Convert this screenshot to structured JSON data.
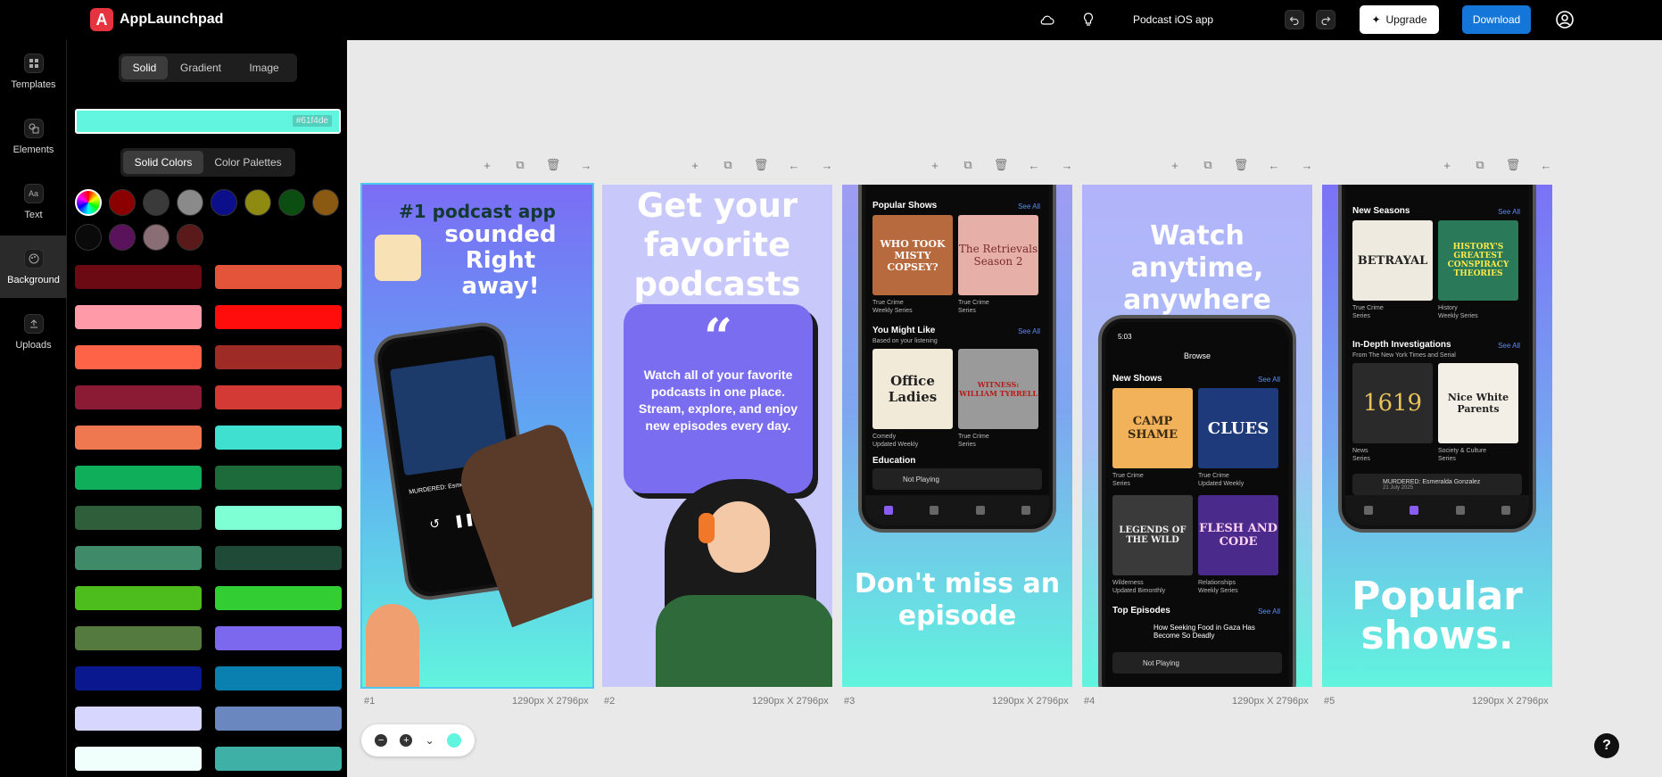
{
  "app": {
    "logo_letter": "A",
    "name": "AppLaunchpad"
  },
  "topbar": {
    "project_name": "Podcast iOS app",
    "upgrade_label": "Upgrade",
    "download_label": "Download"
  },
  "rail": {
    "items": [
      {
        "label": "Templates",
        "icon": "templates-icon"
      },
      {
        "label": "Elements",
        "icon": "elements-icon"
      },
      {
        "label": "Text",
        "icon": "text-icon"
      },
      {
        "label": "Background",
        "icon": "background-icon",
        "active": true
      },
      {
        "label": "Uploads",
        "icon": "upload-icon"
      }
    ]
  },
  "panel": {
    "fill_tabs": [
      "Solid",
      "Gradient",
      "Image"
    ],
    "fill_active": "Solid",
    "current_color": "#61f4de",
    "current_color_label": "#61f4de",
    "color_tabs": [
      "Solid Colors",
      "Color Palettes"
    ],
    "color_tab_active": "Solid Colors",
    "swatches": [
      "#8b0000",
      "#3a3a3a",
      "#8a8a8a",
      "#0b0f8a",
      "#8e8a12",
      "#0c4d12",
      "#8b5a12",
      "#0a0a0a",
      "#5a125a",
      "#8a6e75",
      "#5a1a1a"
    ],
    "bars": [
      [
        "#6b0a12",
        "#e4543a"
      ],
      [
        "#ff9aa8",
        "#ff0d0d"
      ],
      [
        "#ff6347",
        "#9e2b25"
      ],
      [
        "#8b1a35",
        "#d33a35"
      ],
      [
        "#f07850",
        "#40e0d0"
      ],
      [
        "#0fae5a",
        "#1d6b3a"
      ],
      [
        "#2f5e3a",
        "#7fffd4"
      ],
      [
        "#3f8a68",
        "#1f4a38"
      ],
      [
        "#4cbd1d",
        "#32cd32"
      ],
      [
        "#557a3f",
        "#7b68ee"
      ],
      [
        "#0a1890",
        "#0a80b0"
      ],
      [
        "#d6d6ff",
        "#6a88bf"
      ],
      [
        "#f0fffb",
        "#3fb0a6"
      ]
    ]
  },
  "frames": [
    {
      "index": "#1",
      "size": "1290px X 2796px",
      "headline_top": "#1 podcast app",
      "headline": "sounded\nRight\naway!",
      "phone_title": "MURDERED: Esmeralda Gonzalez"
    },
    {
      "index": "#2",
      "size": "1290px X 2796px",
      "headline": "Get your\nfavorite\npodcasts",
      "quote_mark": "“",
      "quote": "Watch all of your favorite podcasts in one place. Stream, explore, and enjoy new episodes every day."
    },
    {
      "index": "#3",
      "size": "1290px X 2796px",
      "section1": "Popular Shows",
      "see_all": "See All",
      "card1": "WHO TOOK MISTY COPSEY?",
      "card2": "The Retrievals Season 2",
      "meta1": "True Crime\nWeekly Series",
      "meta2": "True Crime\nSeries",
      "section2": "You Might Like",
      "section2_sub": "Based on your listening",
      "card3": "Office Ladies",
      "card4": "WITNESS: WILLIAM TYRRELL",
      "meta3": "Comedy\nUpdated Weekly",
      "meta4": "True Crime\nSeries",
      "section3": "Education",
      "now_playing": "Not Playing",
      "footer": "Don't miss an\nepisode"
    },
    {
      "index": "#4",
      "size": "1290px X 2796px",
      "headline": "Watch anytime,\nanywhere",
      "time": "5:03",
      "browse": "Browse",
      "section1": "New Shows",
      "see_all": "See All",
      "card1": "CAMP SHAME",
      "card2": "CLUES",
      "meta1": "True Crime\nSeries",
      "meta2": "True Crime\nUpdated Weekly",
      "card3": "LEGENDS OF THE WILD",
      "card4": "FLESH AND CODE",
      "meta3": "Wilderness\nUpdated Bimonthly",
      "meta4": "Relationships\nWeekly Series",
      "section2": "Top Episodes",
      "episode": "How Seeking Food in Gaza Has Become So Deadly",
      "now_playing": "Not Playing"
    },
    {
      "index": "#5",
      "size": "1290px X 2796px",
      "section1": "New Seasons",
      "see_all": "See All",
      "card1": "BETRAYAL",
      "card2": "HISTORY'S GREATEST CONSPIRACY THEORIES",
      "meta1": "True Crime\nSeries",
      "meta2": "History\nWeekly Series",
      "section2": "In-Depth Investigations",
      "section2_sub": "From The New York Times and Serial",
      "card3": "1619",
      "card4": "Nice White Parents",
      "meta3": "News\nSeries",
      "meta4": "Society & Culture\nSeries",
      "now_playing": "MURDERED: Esmeralda Gonzalez",
      "now_playing_date": "21 July 2025",
      "footer": "Popular\nshows."
    }
  ],
  "help_label": "?"
}
